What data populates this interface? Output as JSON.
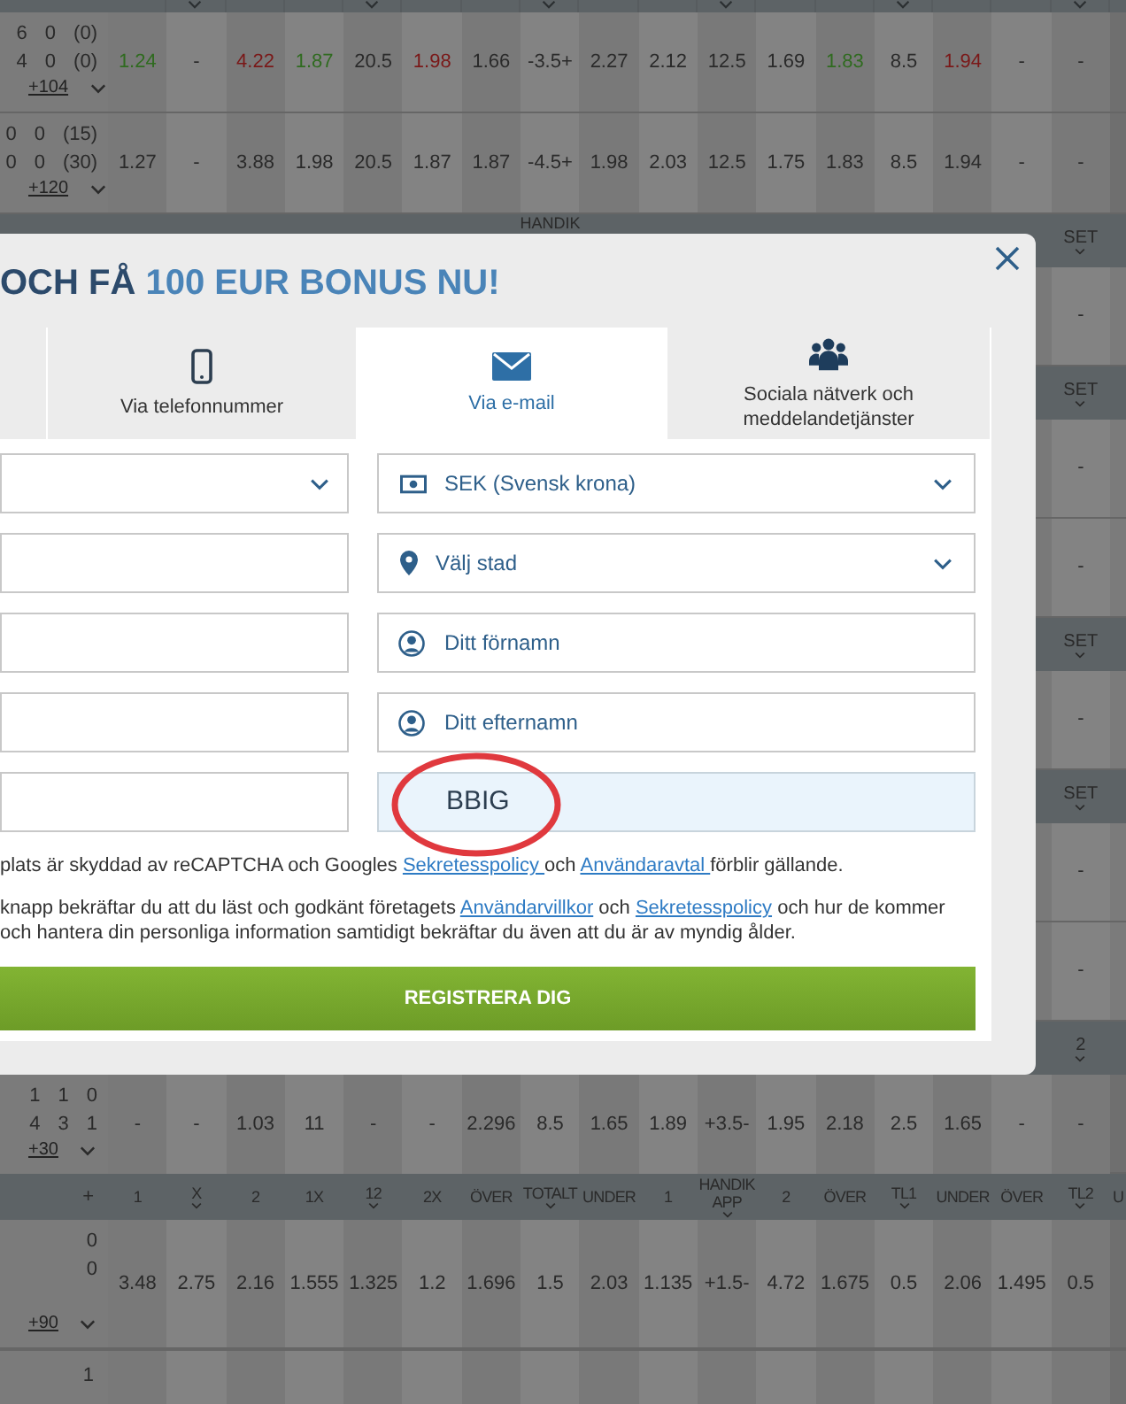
{
  "top_header": {
    "chevrons": [
      false,
      true,
      false,
      false,
      true,
      false,
      false,
      true,
      false,
      false,
      true,
      false,
      false,
      true,
      false,
      false,
      true
    ]
  },
  "rows_top": [
    {
      "scores": [
        [
          "6",
          "0",
          "(0)"
        ],
        [
          "4",
          "0",
          "(0)"
        ]
      ],
      "more": "+104",
      "values": [
        {
          "text": "1.24",
          "color": "#2f6b1f"
        },
        {
          "text": "-"
        },
        {
          "text": "4.22",
          "color": "#7a1818"
        },
        {
          "text": "1.87",
          "color": "#2f6b1f"
        },
        {
          "text": "20.5"
        },
        {
          "text": "1.98",
          "color": "#7a1818"
        },
        {
          "text": "1.66"
        },
        {
          "text": "-3.5+"
        },
        {
          "text": "2.27"
        },
        {
          "text": "2.12"
        },
        {
          "text": "12.5"
        },
        {
          "text": "1.69"
        },
        {
          "text": "1.83",
          "color": "#2f6b1f"
        },
        {
          "text": "8.5"
        },
        {
          "text": "1.94",
          "color": "#7a1818"
        },
        {
          "text": "-"
        },
        {
          "text": "-"
        }
      ]
    },
    {
      "scores": [
        [
          "0",
          "0",
          "(15)"
        ],
        [
          "0",
          "0",
          "(30)"
        ]
      ],
      "more": "+120",
      "values": [
        {
          "text": "1.27"
        },
        {
          "text": "-"
        },
        {
          "text": "3.88"
        },
        {
          "text": "1.98"
        },
        {
          "text": "20.5"
        },
        {
          "text": "1.87"
        },
        {
          "text": "1.87"
        },
        {
          "text": "-4.5+"
        },
        {
          "text": "1.98"
        },
        {
          "text": "2.03"
        },
        {
          "text": "12.5"
        },
        {
          "text": "1.75"
        },
        {
          "text": "1.83"
        },
        {
          "text": "8.5"
        },
        {
          "text": "1.94"
        },
        {
          "text": "-"
        },
        {
          "text": "-"
        }
      ]
    }
  ],
  "middle_rows": [
    {
      "kind": "header",
      "label_center": "HANDIK",
      "label_end": "SET"
    },
    {
      "kind": "row",
      "value_end": "-"
    },
    {
      "kind": "header",
      "label_end": "SET"
    },
    {
      "kind": "row",
      "value_end": "-"
    },
    {
      "kind": "row",
      "value_end": "-"
    },
    {
      "kind": "header",
      "label_end": "SET"
    },
    {
      "kind": "row",
      "value_end": "-"
    },
    {
      "kind": "header",
      "label_end": "SET"
    },
    {
      "kind": "row",
      "value_end": "-"
    },
    {
      "kind": "row",
      "value_end": "-"
    },
    {
      "kind": "header",
      "label_end": "2"
    }
  ],
  "rows_bottom": [
    {
      "kind": "row",
      "scores": [
        [
          "1",
          "1",
          "0"
        ],
        [
          "4",
          "3",
          "1"
        ]
      ],
      "more": "+30",
      "values": [
        {
          "text": "-"
        },
        {
          "text": "-"
        },
        {
          "text": "1.03"
        },
        {
          "text": "11"
        },
        {
          "text": "-"
        },
        {
          "text": "-"
        },
        {
          "text": "2.296"
        },
        {
          "text": "8.5"
        },
        {
          "text": "1.65"
        },
        {
          "text": "1.89"
        },
        {
          "text": "+3.5-"
        },
        {
          "text": "1.95"
        },
        {
          "text": "2.18"
        },
        {
          "text": "2.5"
        },
        {
          "text": "1.65"
        },
        {
          "text": "-"
        },
        {
          "text": "-"
        }
      ]
    },
    {
      "kind": "header",
      "lead": "+",
      "columns": [
        {
          "label": "1",
          "chevron": false
        },
        {
          "label": "X",
          "chevron": true
        },
        {
          "label": "2",
          "chevron": false
        },
        {
          "label": "1X",
          "chevron": false
        },
        {
          "label": "12",
          "chevron": true
        },
        {
          "label": "2X",
          "chevron": false
        },
        {
          "label": "ÖVER",
          "chevron": false
        },
        {
          "label": "TOTALT",
          "chevron": true
        },
        {
          "label": "UNDER",
          "chevron": false
        },
        {
          "label": "1",
          "chevron": false
        },
        {
          "label": "HANDIK APP",
          "chevron": true
        },
        {
          "label": "2",
          "chevron": false
        },
        {
          "label": "ÖVER",
          "chevron": false
        },
        {
          "label": "TL1",
          "chevron": true
        },
        {
          "label": "UNDER",
          "chevron": false
        },
        {
          "label": "ÖVER",
          "chevron": false
        },
        {
          "label": "TL2",
          "chevron": true
        },
        {
          "label": "U",
          "chevron": false
        }
      ]
    },
    {
      "kind": "row",
      "scores": [
        [
          "0"
        ],
        [
          "0"
        ]
      ],
      "more": "+90",
      "values": [
        {
          "text": "3.48"
        },
        {
          "text": "2.75"
        },
        {
          "text": "2.16"
        },
        {
          "text": "1.555"
        },
        {
          "text": "1.325"
        },
        {
          "text": "1.2"
        },
        {
          "text": "1.696"
        },
        {
          "text": "1.5"
        },
        {
          "text": "2.03"
        },
        {
          "text": "1.135"
        },
        {
          "text": "+1.5-"
        },
        {
          "text": "4.72"
        },
        {
          "text": "1.675"
        },
        {
          "text": "0.5"
        },
        {
          "text": "2.06"
        },
        {
          "text": "1.495"
        },
        {
          "text": "0.5"
        }
      ]
    },
    {
      "kind": "partial",
      "scores": [
        [
          "1"
        ]
      ]
    }
  ],
  "modal": {
    "title_lead": "OCH FÅ",
    "title_highlight": "100 EUR BONUS NU!",
    "tabs": [
      {
        "selected": false
      },
      {
        "label": "Via telefonnummer",
        "selected": false
      },
      {
        "label": "Via e-mail",
        "selected": true
      },
      {
        "label": "Sociala nätverk och meddelandetjänster",
        "selected": false
      }
    ],
    "left_fields": [
      {
        "kind": "select"
      },
      {
        "kind": "input"
      },
      {
        "kind": "input"
      },
      {
        "kind": "input"
      },
      {
        "kind": "input"
      }
    ],
    "right_fields": [
      {
        "kind": "select",
        "text": "SEK (Svensk krona)"
      },
      {
        "kind": "select",
        "text": "Välj stad"
      },
      {
        "kind": "input",
        "placeholder": "Ditt förnamn"
      },
      {
        "kind": "input",
        "placeholder": "Ditt efternamn"
      },
      {
        "kind": "promo",
        "value": "BBIG",
        "circled": true
      }
    ],
    "notice": [
      {
        "kind": "text",
        "text": "plats är skyddad av reCAPTCHA och Googles "
      },
      {
        "kind": "link",
        "text": "Sekretesspolicy "
      },
      {
        "kind": "text",
        "text": "och "
      },
      {
        "kind": "link",
        "text": "Användaravtal "
      },
      {
        "kind": "text",
        "text": "förblir gällande."
      }
    ],
    "consent": [
      {
        "kind": "text",
        "text": "knapp bekräftar du att du läst och godkänt företagets "
      },
      {
        "kind": "link",
        "text": "Användarvillkor"
      },
      {
        "kind": "text",
        "text": " och "
      },
      {
        "kind": "link",
        "text": "Sekretesspolicy"
      },
      {
        "kind": "text",
        "text": " och hur de kommer"
      },
      {
        "kind": "break"
      },
      {
        "kind": "text",
        "text": "och hantera din personliga information samtidigt bekräftar du även att du är av myndig ålder."
      }
    ],
    "submit": "REGISTRERA DIG"
  }
}
